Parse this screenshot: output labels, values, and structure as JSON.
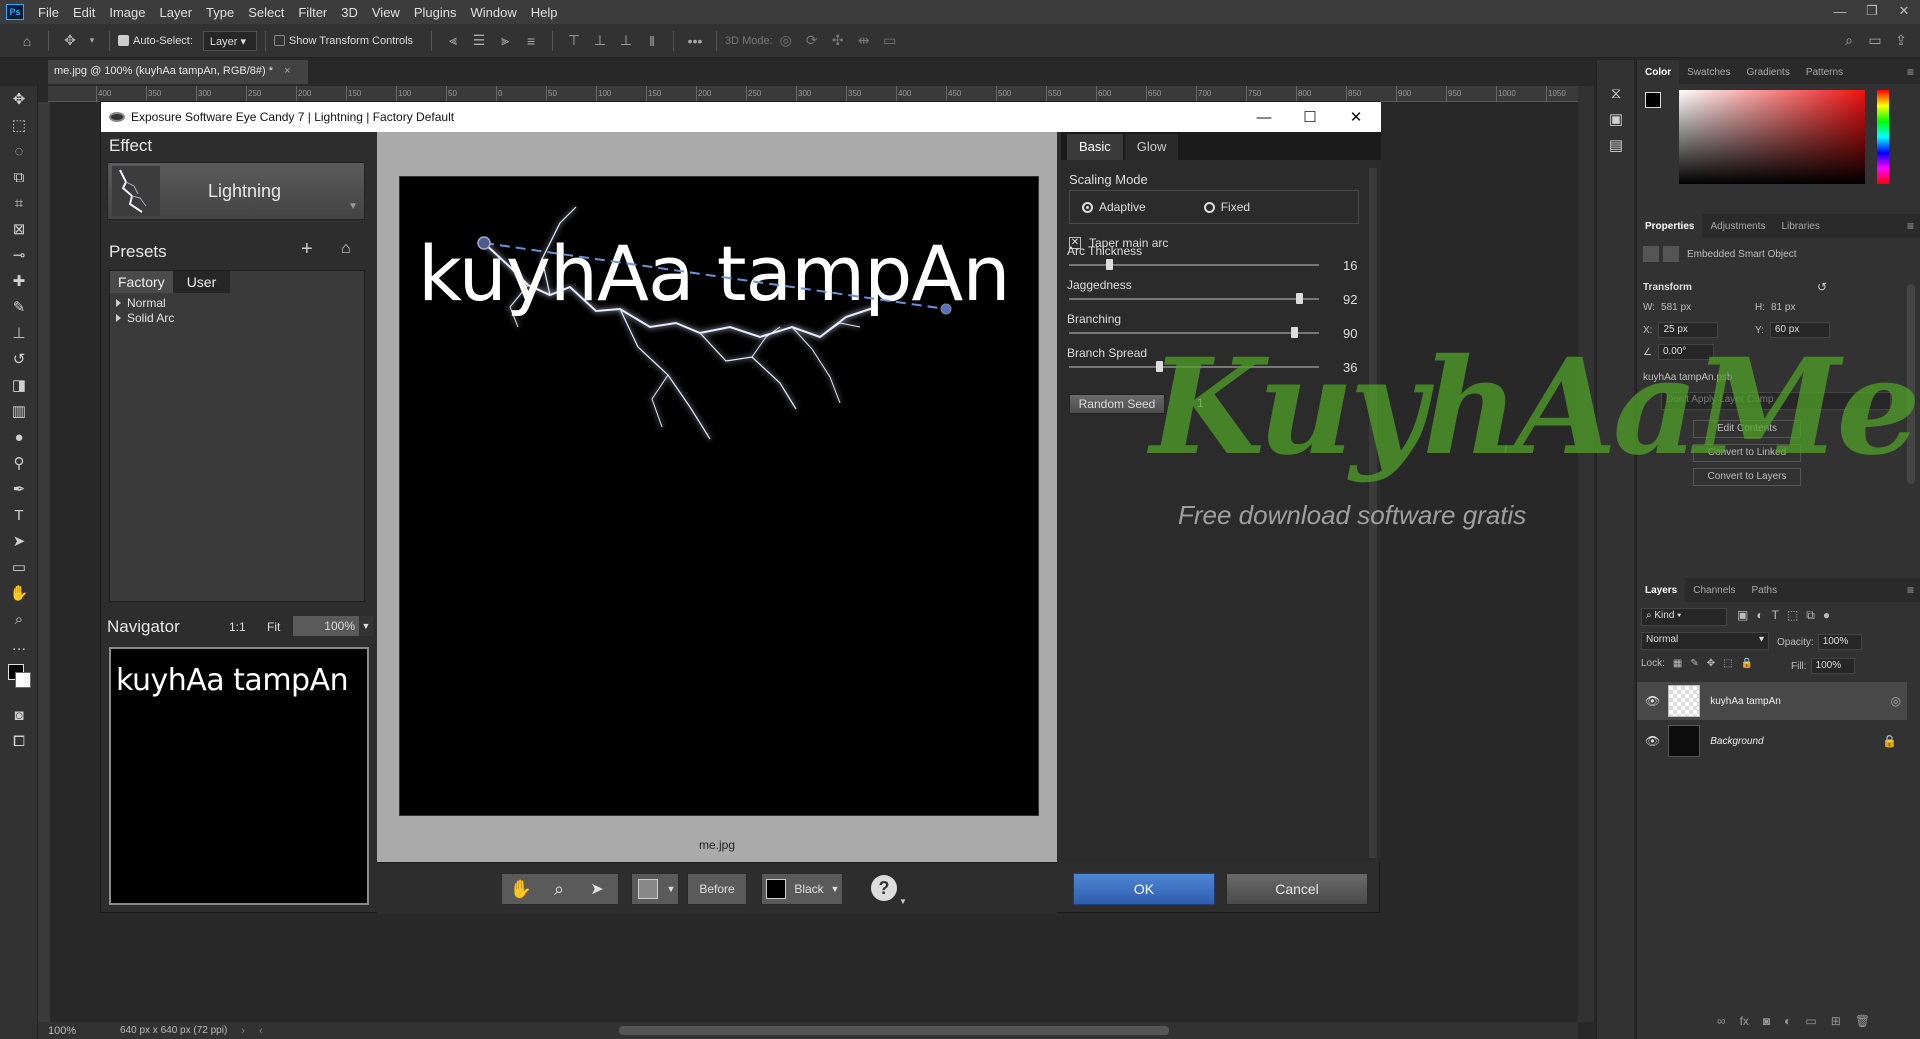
{
  "menubar": {
    "logo": "Ps",
    "items": [
      "File",
      "Edit",
      "Image",
      "Layer",
      "Type",
      "Select",
      "Filter",
      "3D",
      "View",
      "Plugins",
      "Window",
      "Help"
    ]
  },
  "options": {
    "auto_select": "Auto-Select:",
    "layer_dd": "Layer",
    "show_transform": "Show Transform Controls",
    "mode_3d": "3D Mode:"
  },
  "doc_tab": "me.jpg @ 100% (kuyhAa tampAn, RGB/8#) *",
  "ruler_ticks": [
    "400",
    "350",
    "300",
    "250",
    "200",
    "150",
    "100",
    "50",
    "0",
    "50",
    "100",
    "150",
    "200",
    "250",
    "300",
    "350",
    "400",
    "450",
    "500",
    "550",
    "600",
    "650",
    "700",
    "750",
    "800",
    "850",
    "900",
    "950",
    "1000",
    "1050"
  ],
  "status": {
    "zoom": "100%",
    "size": "640 px x 640 px (72 ppi)"
  },
  "dialog": {
    "title": "Exposure Software Eye Candy 7 | Lightning | Factory Default",
    "effect_heading": "Effect",
    "effect_name": "Lightning",
    "presets_heading": "Presets",
    "preset_tabs": [
      "Factory",
      "User"
    ],
    "preset_items": [
      "Normal",
      "Solid Arc"
    ],
    "navigator_heading": "Navigator",
    "nav_1to1": "1:1",
    "nav_fit": "Fit",
    "nav_zoom": "100%",
    "nav_text": "kuyhAa tampAn",
    "canvas_text": "kuyhAa tampAn",
    "filename": "me.jpg",
    "before_label": "Before",
    "bg_color_label": "Black",
    "settings_tabs": [
      "Basic",
      "Glow"
    ],
    "scaling_mode_label": "Scaling Mode",
    "scaling_options": [
      "Adaptive",
      "Fixed"
    ],
    "taper_label": "Taper main arc",
    "sliders": [
      {
        "label": "Arc Thickness",
        "value": 16,
        "max": 100
      },
      {
        "label": "Jaggedness",
        "value": 92,
        "max": 100
      },
      {
        "label": "Branching",
        "value": 90,
        "max": 100
      },
      {
        "label": "Branch Spread",
        "value": 36,
        "max": 100
      }
    ],
    "random_seed_label": "Random Seed",
    "random_seed_value": "1",
    "ok_label": "OK",
    "cancel_label": "Cancel"
  },
  "panels": {
    "color_tabs": [
      "Color",
      "Swatches",
      "Gradients",
      "Patterns"
    ],
    "props_tabs": [
      "Properties",
      "Adjustments",
      "Libraries"
    ],
    "smart_object_label": "Embedded Smart Object",
    "transform_heading": "Transform",
    "w_label": "W:",
    "w_value": "581 px",
    "h_label": "H:",
    "h_value": "81 px",
    "x_label": "X:",
    "x_value": "25 px",
    "y_label": "Y:",
    "y_value": "60 px",
    "angle_value": "0.00°",
    "psb_name": "kuyhAa tampAn.psb",
    "layer_comp_label": "Don't Apply Layer Comp",
    "edit_contents": "Edit Contents",
    "convert_linked": "Convert to Linked",
    "convert_layers": "Convert to Layers",
    "layers_tabs": [
      "Layers",
      "Channels",
      "Paths"
    ],
    "kind_label": "Kind",
    "blend_mode": "Normal",
    "opacity_label": "Opacity:",
    "opacity_value": "100%",
    "lock_label": "Lock:",
    "fill_label": "Fill:",
    "fill_value": "100%",
    "layers": [
      "kuyhAa tampAn",
      "Background"
    ]
  },
  "watermark": {
    "brand": "KuyhAaMe",
    "tagline": "Free download software gratis"
  },
  "colors": {
    "accent_blue": "#3d6fc2",
    "ps_dark": "#323232",
    "watermark_green": "#5aa02c"
  }
}
